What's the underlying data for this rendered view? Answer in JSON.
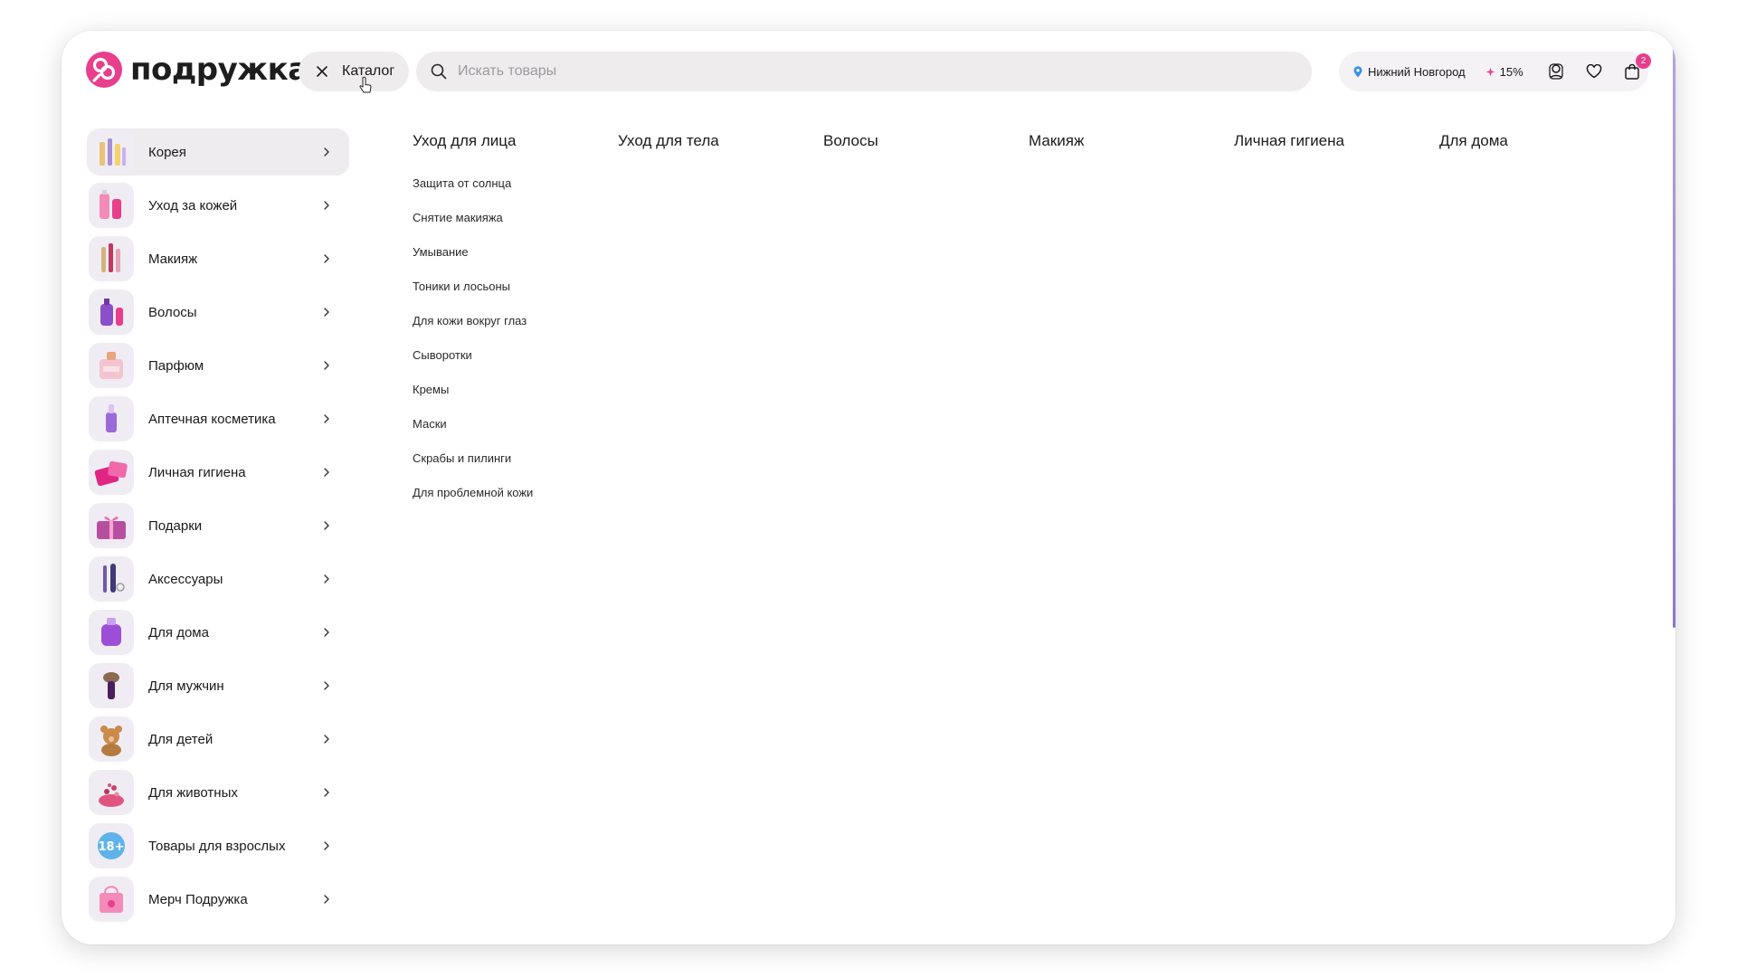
{
  "brand": {
    "name": "подружка",
    "accent": "#e83e8c"
  },
  "header": {
    "catalog_label": "Каталог",
    "search_placeholder": "Искать товары",
    "city": "Нижний Новгород",
    "discount": "15%",
    "cart_count": "2"
  },
  "sidebar": {
    "items": [
      {
        "label": "Корея",
        "icon": "korea-cosmetics-icon",
        "active": true
      },
      {
        "label": "Уход за кожей",
        "icon": "skincare-icon"
      },
      {
        "label": "Макияж",
        "icon": "makeup-icon"
      },
      {
        "label": "Волосы",
        "icon": "hair-icon"
      },
      {
        "label": "Парфюм",
        "icon": "perfume-icon"
      },
      {
        "label": "Аптечная косметика",
        "icon": "pharmacy-cosmetics-icon"
      },
      {
        "label": "Личная гигиена",
        "icon": "hygiene-icon"
      },
      {
        "label": "Подарки",
        "icon": "gift-icon"
      },
      {
        "label": "Аксессуары",
        "icon": "accessories-icon"
      },
      {
        "label": "Для дома",
        "icon": "home-icon"
      },
      {
        "label": "Для мужчин",
        "icon": "men-icon"
      },
      {
        "label": "Для детей",
        "icon": "kids-icon"
      },
      {
        "label": "Для животных",
        "icon": "pets-icon"
      },
      {
        "label": "Товары для взрослых",
        "icon": "adult-18-icon"
      },
      {
        "label": "Мерч Подружка",
        "icon": "merch-bag-icon"
      }
    ]
  },
  "content": {
    "tabs": [
      "Уход для лица",
      "Уход для тела",
      "Волосы",
      "Макияж",
      "Личная гигиена",
      "Для дома"
    ],
    "subcategories": [
      "Защита от солнца",
      "Снятие макияжа",
      "Умывание",
      "Тоники и лосьоны",
      "Для кожи вокруг глаз",
      "Сыворотки",
      "Кремы",
      "Маски",
      "Скрабы и пилинги",
      "Для проблемной кожи"
    ]
  }
}
